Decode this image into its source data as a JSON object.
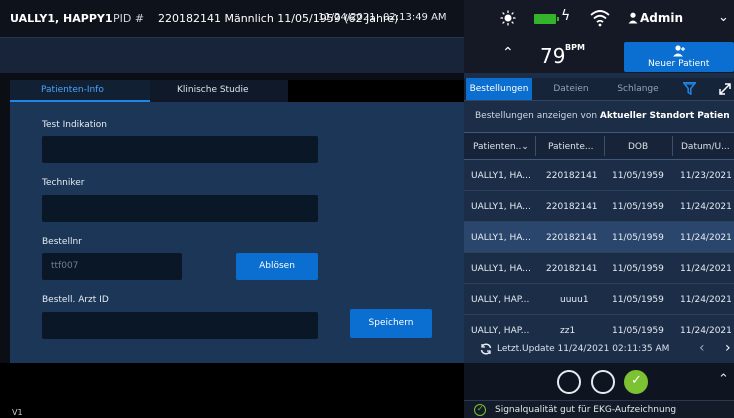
{
  "topbar": {
    "date": "11/24/2021",
    "time": "02:13:49 AM",
    "user": "Admin"
  },
  "patient": {
    "name": "UALLY1, HAPPY1",
    "pid_label": "PID #",
    "details": "220182141 Männlich 11/05/1959 (62 Jahre)"
  },
  "heart_rate": {
    "value": "79",
    "unit": "BPM"
  },
  "new_patient_label": "Neuer Patient",
  "left_tabs": {
    "patient_info": "Patienten-Info",
    "clinical_study": "Klinische Studie"
  },
  "form": {
    "indication_label": "Test Indikation",
    "indication_value": "",
    "technician_label": "Techniker",
    "technician_value": "",
    "order_no_label": "Bestellnr",
    "order_no_value": "ttf007",
    "replace_button": "Ablösen",
    "physician_id_label": "Bestell. Arzt ID",
    "physician_id_value": "",
    "save_button": "Speichern"
  },
  "right_tabs": {
    "orders": "Bestellungen",
    "files": "Dateien",
    "queue": "Schlange"
  },
  "filter": {
    "prefix": "Bestellungen anzeigen  von",
    "value": "Aktueller Standort Patien"
  },
  "orders_table": {
    "headers": [
      "Patienten..⌄",
      "Patiente...",
      "DOB",
      "Datum/U..."
    ],
    "rows": [
      [
        "UALLY1, HA...",
        "220182141",
        "11/05/1959",
        "11/23/2021"
      ],
      [
        "UALLY1, HA...",
        "220182141",
        "11/05/1959",
        "11/24/2021"
      ],
      [
        "UALLY1, HA...",
        "220182141",
        "11/05/1959",
        "11/24/2021"
      ],
      [
        "UALLY1, HA...",
        "220182141",
        "11/05/1959",
        "11/24/2021"
      ],
      [
        "UALLY, HAP...",
        "uuuu1",
        "11/05/1959",
        "11/24/2021"
      ],
      [
        "UALLY, HAP...",
        "zz1",
        "11/05/1959",
        "11/24/2021"
      ]
    ],
    "selected_row": 2
  },
  "last_update": "Letzt.Update 11/24/2021 02:11:35 AM",
  "lead_label": "V1",
  "signal_quality": "Signalqualität gut für EKG-Aufzeichnung",
  "colors": {
    "accent": "#0a6fd0",
    "ok_green": "#7cc232",
    "battery_green": "#33b42b"
  }
}
